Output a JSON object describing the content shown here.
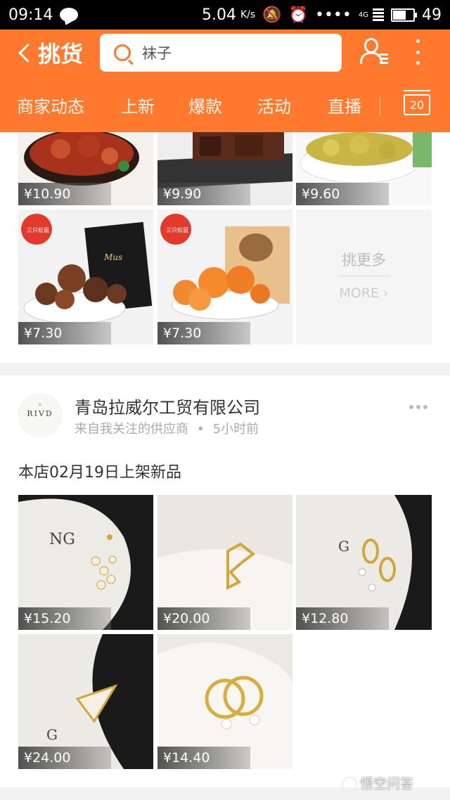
{
  "status_bar": {
    "time": "09:14",
    "speed": "5.04",
    "speed_unit": "K/s",
    "network": "4G",
    "battery": "49"
  },
  "header": {
    "title": "挑货",
    "search_text": "袜子",
    "tabs": [
      "商家动态",
      "上新",
      "爆款",
      "活动",
      "直播"
    ],
    "calendar_day": "20",
    "accent_color": "#ff7a2e"
  },
  "feed1": {
    "prices": [
      "¥10.90",
      "¥9.90",
      "¥9.60",
      "¥7.30",
      "¥7.30"
    ],
    "badges": [
      "三只松鼠",
      "三只松鼠"
    ],
    "more_cn": "挑更多",
    "more_en": "MORE ›"
  },
  "feed2": {
    "logo_text": "RIVD",
    "store_name": "青岛拉威尔工贸有限公司",
    "store_source": "来自我关注的供应商",
    "store_time": "5小时前",
    "post_text": "本店02月19日上架新品",
    "prices": [
      "¥15.20",
      "¥20.00",
      "¥12.80",
      "¥24.00",
      "¥14.40"
    ]
  },
  "watermark": "悟空问答"
}
